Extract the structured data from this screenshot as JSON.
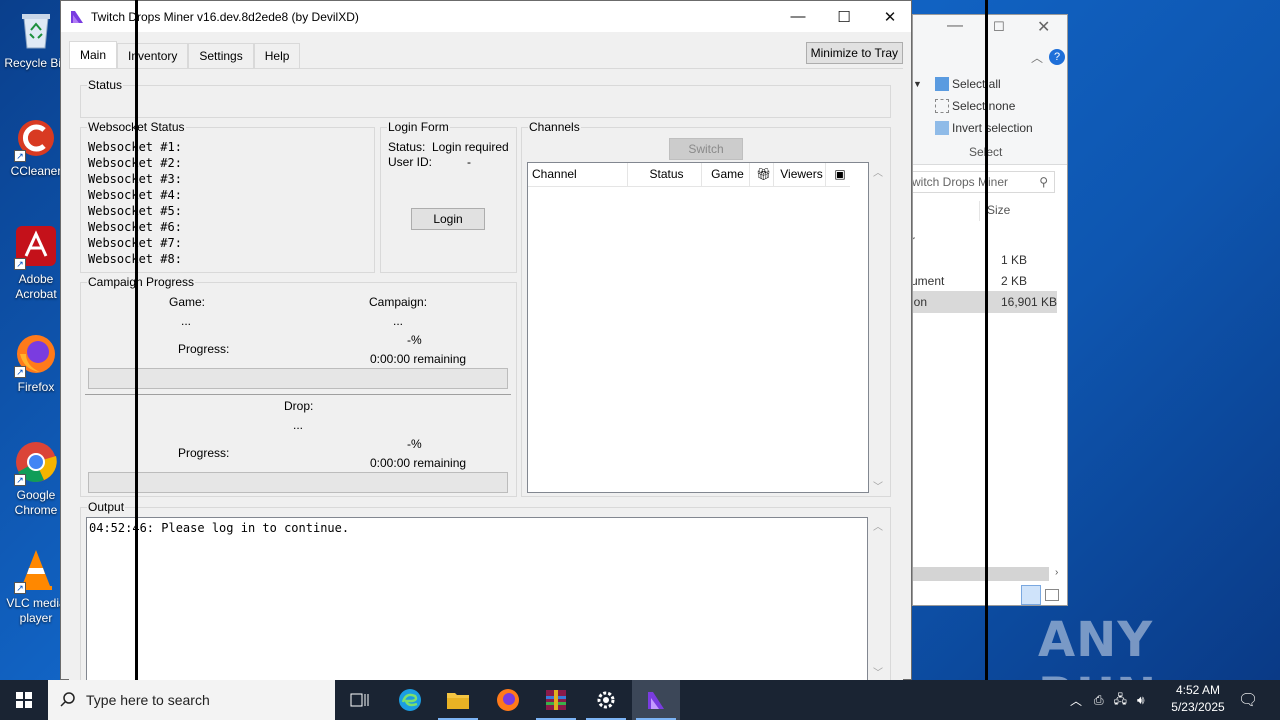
{
  "desktop": {
    "icons": [
      {
        "label": "Recycle Bin",
        "icon": "recycle-bin-icon"
      },
      {
        "label": "CCleaner",
        "icon": "ccleaner-icon"
      },
      {
        "label": "Adobe Acrobat",
        "icon": "adobe-acrobat-icon"
      },
      {
        "label": "Firefox",
        "icon": "firefox-icon"
      },
      {
        "label": "Google Chrome",
        "icon": "chrome-icon"
      },
      {
        "label": "VLC media player",
        "icon": "vlc-icon"
      }
    ],
    "watermark": "ANY RUN"
  },
  "explorer": {
    "select_all": "Select all",
    "select_none": "Select none",
    "invert_selection": "Invert selection",
    "select_group": "Select",
    "search_placeholder": "witch Drops Miner",
    "size_header": "Size",
    "rows": [
      {
        "name": "r",
        "size": ""
      },
      {
        "name": "",
        "size": "1 KB"
      },
      {
        "name": "ument",
        "size": "2 KB"
      },
      {
        "name": "ion",
        "size": "16,901 KB"
      }
    ]
  },
  "window": {
    "title": "Twitch Drops Miner v16.dev.8d2ede8 (by DevilXD)",
    "tabs": [
      "Main",
      "Inventory",
      "Settings",
      "Help"
    ],
    "active_tab": "Main",
    "minimize_to_tray": "Minimize to Tray"
  },
  "status": {
    "legend": "Status",
    "text": ""
  },
  "websocket": {
    "legend": "Websocket Status",
    "rows": [
      "Websocket #1:",
      "Websocket #2:",
      "Websocket #3:",
      "Websocket #4:",
      "Websocket #5:",
      "Websocket #6:",
      "Websocket #7:",
      "Websocket #8:"
    ]
  },
  "login": {
    "legend": "Login Form",
    "status_label": "Status:",
    "status_value": "Login required",
    "userid_label": "User ID:",
    "userid_value": "-",
    "login_button": "Login"
  },
  "campaign": {
    "legend": "Campaign Progress",
    "game_label": "Game:",
    "game_value": "...",
    "campaign_label": "Campaign:",
    "campaign_value": "...",
    "progress_label": "Progress:",
    "campaign_percent": "-%",
    "campaign_remaining": "0:00:00 remaining",
    "drop_label": "Drop:",
    "drop_value": "...",
    "drop_progress_label": "Progress:",
    "drop_percent": "-%",
    "drop_remaining": "0:00:00 remaining",
    "campaign_progress_fraction": 0,
    "drop_progress_fraction": 0
  },
  "channels": {
    "legend": "Channels",
    "switch_button": "Switch",
    "columns": [
      "Channel",
      "Status",
      "Game",
      "gift-icon",
      "Viewers",
      "acl-icon"
    ]
  },
  "output": {
    "legend": "Output",
    "lines": [
      "04:52:46: Please log in to continue."
    ]
  },
  "taskbar": {
    "search_placeholder": "Type here to search",
    "time": "4:52 AM",
    "date": "5/23/2025"
  }
}
